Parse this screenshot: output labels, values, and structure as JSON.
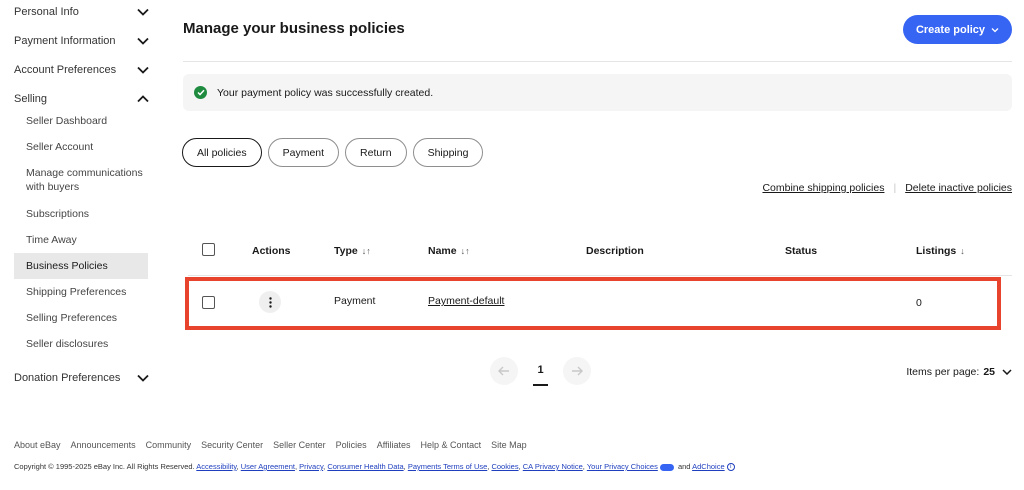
{
  "sidebar": {
    "sections": [
      {
        "label": "Personal Info"
      },
      {
        "label": "Payment Information"
      },
      {
        "label": "Account Preferences"
      },
      {
        "label": "Selling"
      }
    ],
    "selling_items": [
      {
        "label": "Seller Dashboard"
      },
      {
        "label": "Seller Account"
      },
      {
        "label": "Manage communications with buyers"
      },
      {
        "label": "Subscriptions"
      },
      {
        "label": "Time Away"
      },
      {
        "label": "Business Policies"
      },
      {
        "label": "Shipping Preferences"
      },
      {
        "label": "Selling Preferences"
      },
      {
        "label": "Seller disclosures"
      }
    ],
    "donation": {
      "label": "Donation Preferences"
    }
  },
  "header": {
    "title": "Manage your business policies",
    "create_button": "Create policy"
  },
  "alert": {
    "message": "Your payment policy was successfully created."
  },
  "filters": [
    {
      "label": "All policies"
    },
    {
      "label": "Payment"
    },
    {
      "label": "Return"
    },
    {
      "label": "Shipping"
    }
  ],
  "links": {
    "combine": "Combine shipping policies",
    "separator": "|",
    "delete": "Delete inactive policies"
  },
  "table": {
    "columns": {
      "actions": "Actions",
      "type": "Type",
      "name": "Name",
      "description": "Description",
      "status": "Status",
      "listings": "Listings"
    },
    "rows": [
      {
        "type": "Payment",
        "name": "Payment-default",
        "description": "",
        "status": "",
        "listings": "0"
      }
    ]
  },
  "pagination": {
    "current_page": "1",
    "items_per_page_label": "Items per page:",
    "items_per_page_value": "25"
  },
  "footer": {
    "links": [
      "About eBay",
      "Announcements",
      "Community",
      "Security Center",
      "Seller Center",
      "Policies",
      "Affiliates",
      "Help & Contact",
      "Site Map"
    ],
    "copyright": "Copyright © 1995-2025 eBay Inc. All Rights Reserved.",
    "legal_links": [
      "Accessibility",
      "User Agreement",
      "Privacy",
      "Consumer Health Data",
      "Payments Terms of Use",
      "Cookies",
      "CA Privacy Notice",
      "Your Privacy Choices"
    ],
    "and_text": "and",
    "adchoice": "AdChoice"
  }
}
